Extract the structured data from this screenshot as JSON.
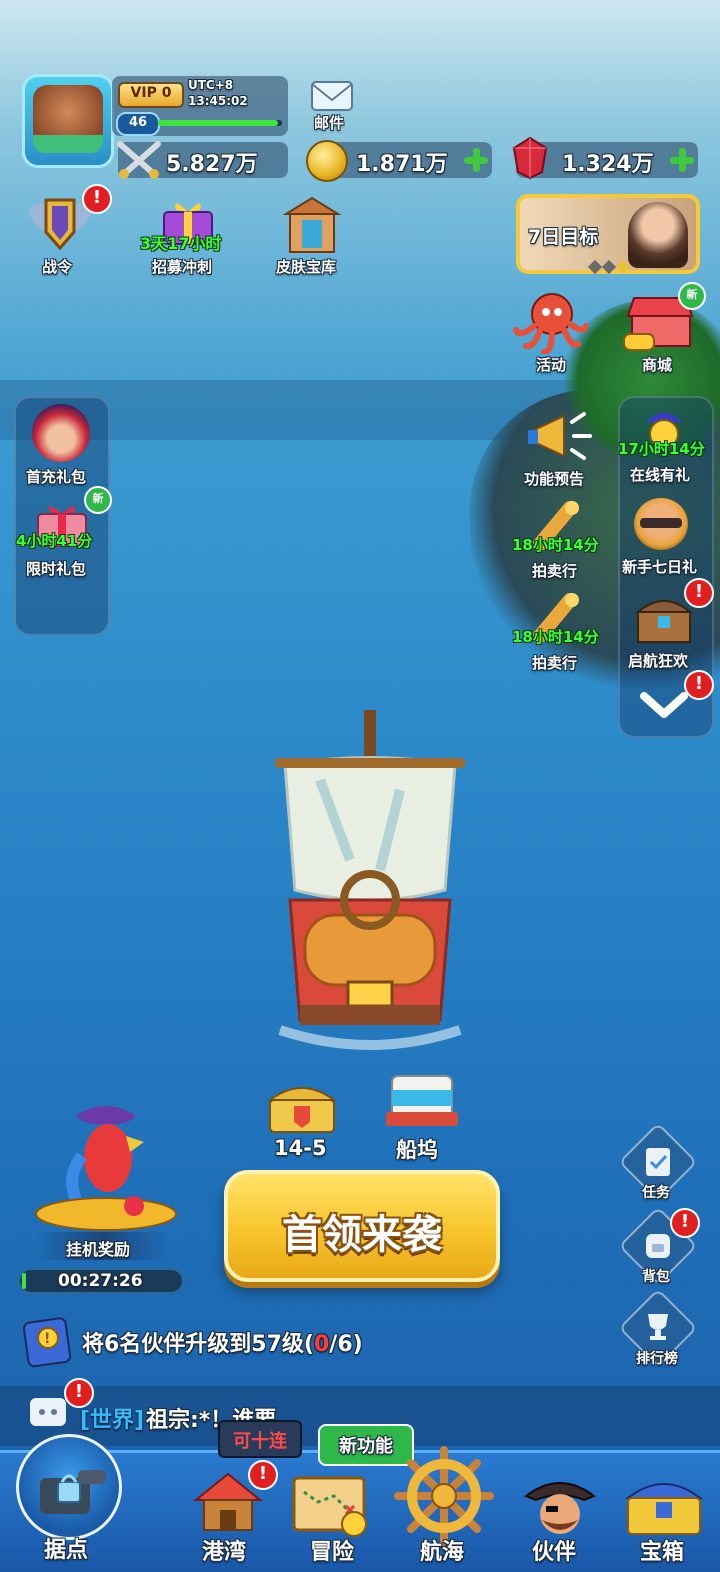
{
  "player": {
    "vip": "VIP 0",
    "timezone": "UTC+8",
    "time": "13:45:02",
    "level": "46",
    "level_progress": 0.97
  },
  "mail_label": "邮件",
  "resources": {
    "power": "5.827万",
    "gold": "1.871万",
    "gems": "1.324万"
  },
  "top_icons": {
    "battle_pass": "战令",
    "recruit_timer": "3天17小时",
    "recruit": "招募冲刺",
    "skin_vault": "皮肤宝库",
    "seven_day_goal": "7日目标"
  },
  "right_icons": {
    "event": "活动",
    "shop": "商城",
    "new_tag": "新",
    "preview": "功能预告",
    "online_timer": "17小时14分",
    "online_gift": "在线有礼",
    "auction1_timer": "18小时14分",
    "auction1": "拍卖行",
    "newbie_gift": "新手七日礼",
    "auction2_timer": "18小时14分",
    "auction2": "拍卖行",
    "voyage_carnival": "启航狂欢"
  },
  "left_panel": {
    "first_charge": "首充礼包",
    "limited_timer": "4小时41分",
    "limited_gift": "限时礼包",
    "new_tag": "新"
  },
  "stage": {
    "chest_label": "14-5",
    "dock_label": "船坞"
  },
  "idle": {
    "label": "挂机奖励",
    "timer": "00:27:26"
  },
  "main_button": "首领来袭",
  "side_buttons": {
    "tasks": "任务",
    "backpack": "背包",
    "leaderboard": "排行榜"
  },
  "quest": {
    "prefix": "将6名伙伴升级到57级(",
    "current": "0",
    "suffix": "/6)"
  },
  "chat": {
    "channel": "[世界]",
    "message": "祖宗:*！谁要"
  },
  "badges": {
    "ten_pull": "可十连",
    "new_feature": "新功能",
    "alert": "!"
  },
  "nav": {
    "stronghold": "据点",
    "harbor": "港湾",
    "adventure": "冒险",
    "voyage": "航海",
    "partners": "伙伴",
    "chest": "宝箱"
  },
  "colors": {
    "gold_button": "#f7c52b",
    "timer_green": "#3cff3c",
    "alert_red": "#e02020",
    "quest_red": "#ff3b3b"
  }
}
